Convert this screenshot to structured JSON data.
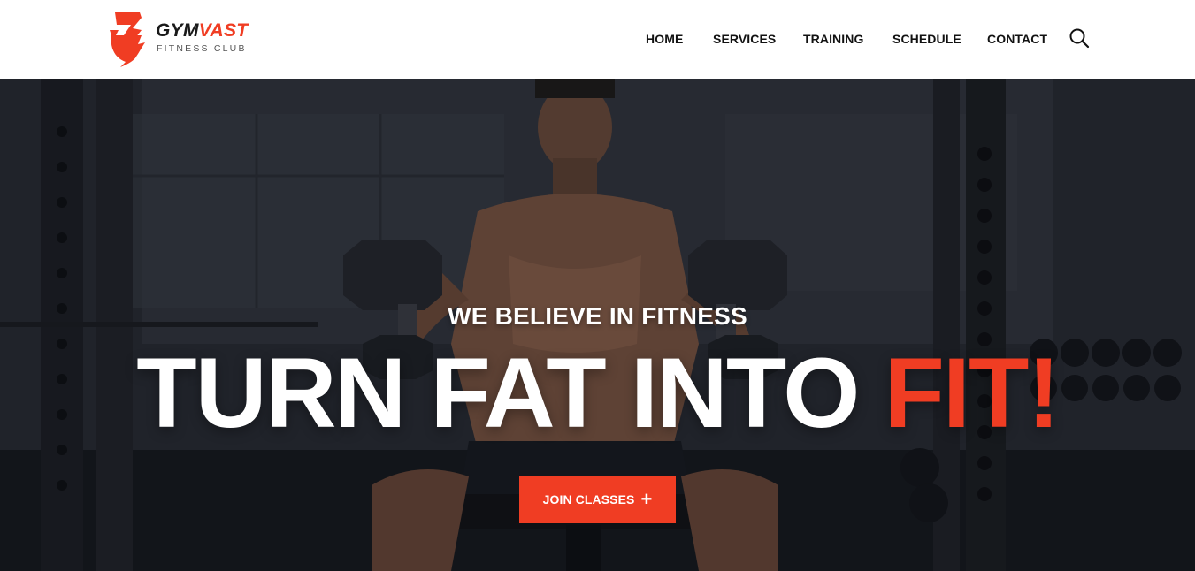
{
  "brand": {
    "name_part1": "GYM",
    "name_part2": "VAST",
    "tagline": "FITNESS CLUB",
    "accent_color": "#f03d23"
  },
  "nav": {
    "items": [
      {
        "label": "HOME"
      },
      {
        "label": "SERVICES"
      },
      {
        "label": "TRAINING"
      },
      {
        "label": "SCHEDULE"
      },
      {
        "label": "CONTACT"
      }
    ],
    "search_icon": "search-icon"
  },
  "hero": {
    "subtitle": "WE BELIEVE IN FITNESS",
    "title_main": "TURN FAT INTO ",
    "title_accent": "FIT!",
    "cta_label": "JOIN CLASSES",
    "cta_icon": "+"
  }
}
